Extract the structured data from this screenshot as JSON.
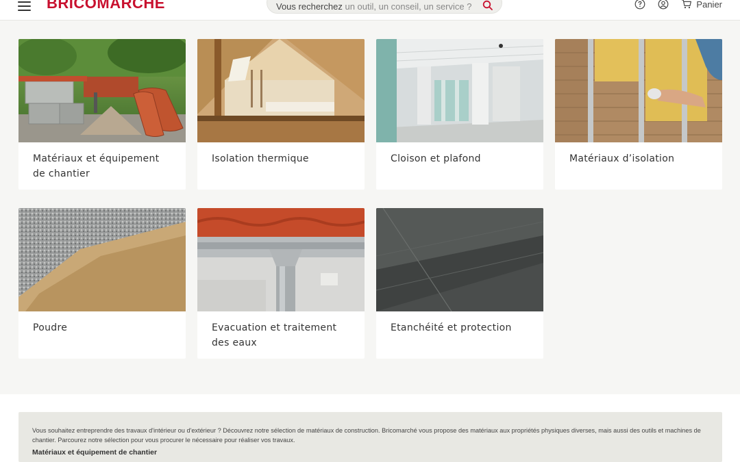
{
  "header": {
    "logo_prefix": "BRICO",
    "logo_suffix": "MARCHE",
    "search_placeholder_lead": "Vous recherchez",
    "search_placeholder_rest": "un outil, un conseil, un service ?",
    "cart_label": "Panier",
    "icons": {
      "menu": "hamburger-menu-icon",
      "search": "search-icon",
      "help": "help-circle-icon",
      "account": "user-icon",
      "cart": "cart-icon"
    },
    "brand_color": "#c8102e"
  },
  "categories": [
    {
      "label": "Matériaux et équipement de chantier",
      "image": "construction-materials-image"
    },
    {
      "label": "Isolation thermique",
      "image": "insulated-attic-image"
    },
    {
      "label": "Cloison et plafond",
      "image": "drywall-room-image"
    },
    {
      "label": "Matériaux d’isolation",
      "image": "insulation-installation-image"
    },
    {
      "label": "Poudre",
      "image": "gravel-and-sand-image"
    },
    {
      "label": "Evacuation et traitement des eaux",
      "image": "gutter-downpipe-image"
    },
    {
      "label": "Etanchéité et protection",
      "image": "waterproof-membrane-image"
    }
  ],
  "seo": {
    "text": "Vous souhaitez entreprendre des travaux d'intérieur ou d'extérieur ? Découvrez notre sélection de matériaux de construction. Bricomarché vous propose des matériaux aux propriétés physiques diverses, mais aussi des outils et machines de chantier. Parcourez notre sélection pour vous procurer le nécessaire pour réaliser vos travaux.",
    "link": "Matériaux et équipement de chantier"
  }
}
